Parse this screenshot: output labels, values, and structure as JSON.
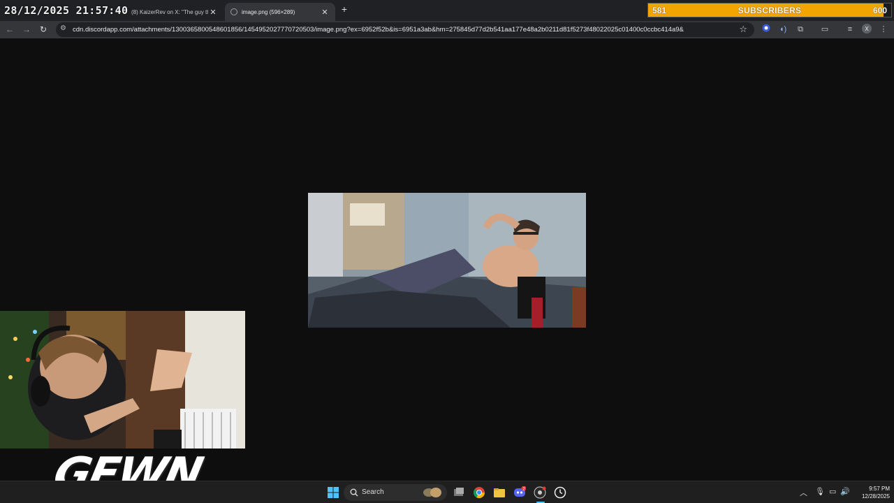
{
  "overlay": {
    "datetime": "28/12/2025 21:57:40",
    "subscriber_goal": {
      "current": "581",
      "label": "SUBSCRIBERS",
      "goal": "600",
      "progress": 0.968,
      "fill_color": "#f2a400"
    },
    "logo_text": "GEWN"
  },
  "browser": {
    "tabs": [
      {
        "title": "(8) KaizerRev on X: \"The guy th",
        "active": false
      },
      {
        "title": "image.png (596×289)",
        "active": true
      }
    ],
    "address": "cdn.discordapp.com/attachments/1300365800548601856/1454952027770720503/image.png?ex=6952f52b&is=6951a3ab&hm=275845d77d2b541aa177e48a2b0211d81f5273f48022025c01400c0ccbc414a9&"
  },
  "taskbar": {
    "search_label": "Search",
    "clock_time": "9:57 PM",
    "clock_date": "12/28/2025",
    "discord_badge": "2"
  },
  "colors": {
    "page_bg": "#0e0e0e",
    "tabbar_bg": "#202124",
    "toolbar_bg": "#35363a",
    "taskbar_bg": "#1f1f1f",
    "accent_gold": "#f2a400"
  }
}
